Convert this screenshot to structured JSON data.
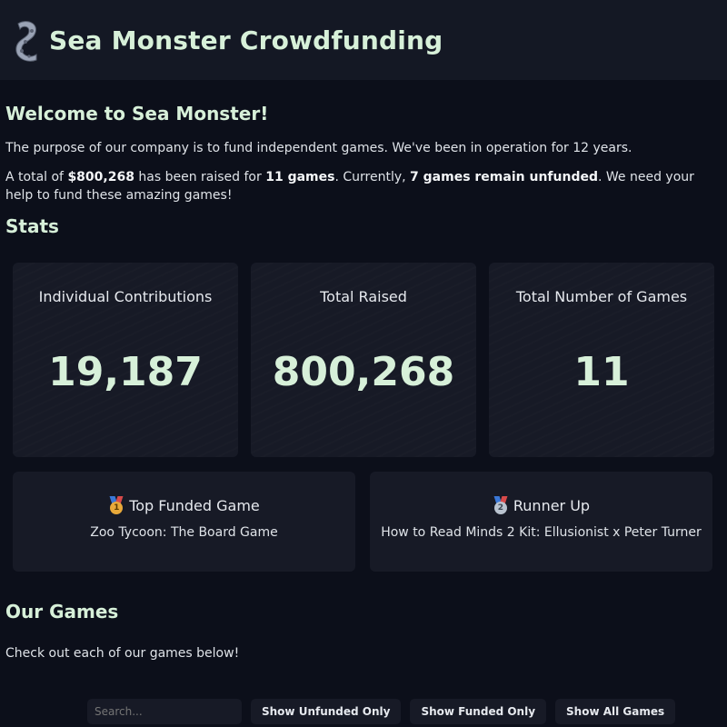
{
  "header": {
    "title": "Sea Monster Crowdfunding",
    "logo_icon": "tentacle-logo-icon"
  },
  "welcome": {
    "heading": "Welcome to Sea Monster!",
    "intro": "The purpose of our company is to fund independent games. We've been in operation for 12 years.",
    "summary_prefix": "A total of ",
    "summary_amount": "$800,268",
    "summary_mid1": " has been raised for ",
    "summary_games": "11 games",
    "summary_mid2": ". Currently, ",
    "summary_unfunded": "7 games remain unfunded",
    "summary_suffix": ". We need your help to fund these amazing games!"
  },
  "stats": {
    "heading": "Stats",
    "cards": [
      {
        "label": "Individual Contributions",
        "value": "19,187"
      },
      {
        "label": "Total Raised",
        "value": "800,268"
      },
      {
        "label": "Total Number of Games",
        "value": "11"
      }
    ]
  },
  "top_games": {
    "first": {
      "title": "Top Funded Game",
      "game": "Zoo Tycoon: The Board Game",
      "medal_number": "1",
      "icon": "gold-medal-icon"
    },
    "second": {
      "title": "Runner Up",
      "game": "How to Read Minds 2 Kit: Ellusionist x Peter Turner",
      "medal_number": "2",
      "icon": "silver-medal-icon"
    }
  },
  "games": {
    "heading": "Our Games",
    "subtitle": "Check out each of our games below!",
    "search_placeholder": "Search...",
    "buttons": [
      "Show Unfunded Only",
      "Show Funded Only",
      "Show All Games"
    ]
  },
  "colors": {
    "background": "#0c0f1a",
    "header": "#141824",
    "card": "#171a26",
    "accent_green": "#d7f0d9"
  }
}
